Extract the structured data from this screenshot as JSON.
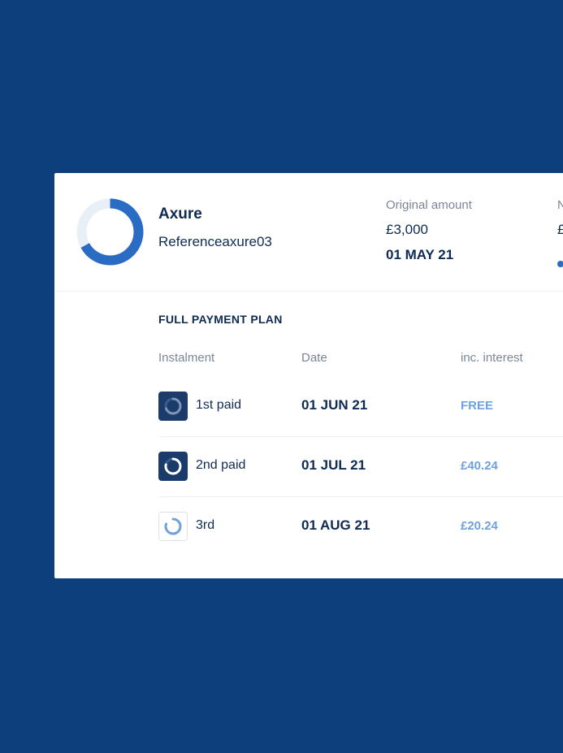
{
  "merchant": {
    "name": "Axure",
    "reference": "Referenceaxure03",
    "progress_fraction": 0.67
  },
  "original": {
    "label": "Original amount",
    "amount": "£3,000",
    "date": "01 MAY 21"
  },
  "next": {
    "label": "N",
    "amount": "£"
  },
  "plan": {
    "title": "FULL PAYMENT PLAN",
    "columns": [
      "Instalment",
      "Date",
      "inc. interest"
    ],
    "rows": [
      {
        "label": "1st paid",
        "date": "01 JUN 21",
        "interest": "FREE",
        "status": "paid"
      },
      {
        "label": "2nd paid",
        "date": "01 JUL 21",
        "interest": "£40.24",
        "status": "paid"
      },
      {
        "label": "3rd",
        "date": "01 AUG 21",
        "interest": "£20.24",
        "status": "pending"
      }
    ]
  },
  "colors": {
    "background": "#0d3f7c",
    "accent": "#2a6bc4",
    "text_dark": "#0f2b52",
    "interest_text": "#6fa1dc"
  },
  "icons": {
    "progress": "progress-ring-icon",
    "instalment": "instalment-progress-icon"
  }
}
